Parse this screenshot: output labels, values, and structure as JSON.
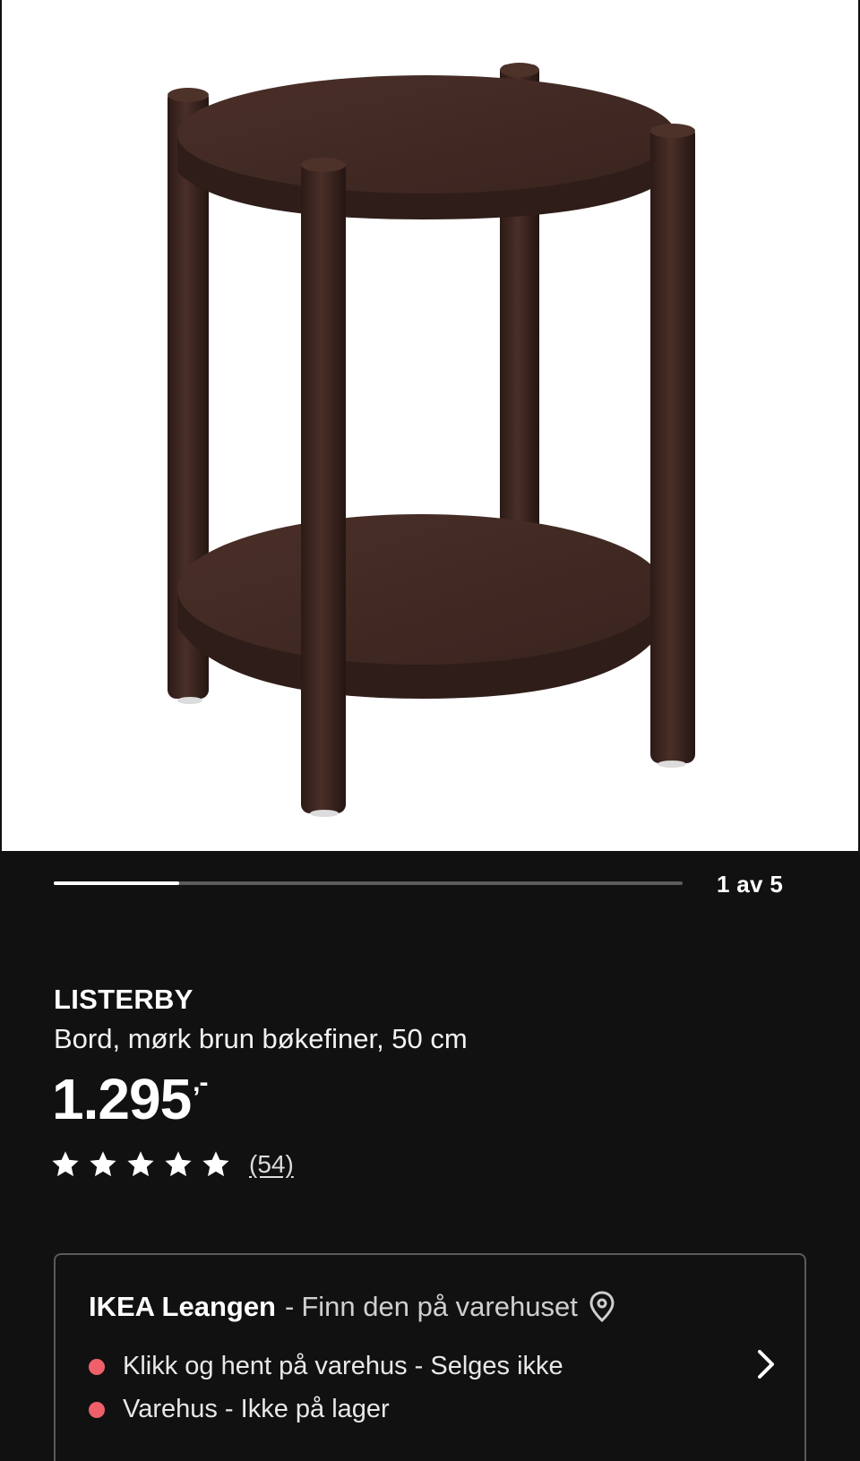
{
  "gallery": {
    "page_indicator": "1 av 5",
    "progress_fraction": 0.2
  },
  "product": {
    "name": "LISTERBY",
    "description": "Bord, mørk brun bøkefiner, 50 cm",
    "price": "1.295",
    "price_suffix": ",-",
    "rating": {
      "stars": 5,
      "max_stars": 5,
      "review_count": "(54)"
    },
    "image_alt_icon": "side-table-image"
  },
  "store": {
    "name": "IKEA Leangen",
    "separator": "-",
    "find_text": "Finn den på varehuset",
    "pin_icon": "location-pin-icon",
    "chevron_icon": "chevron-right-icon",
    "statuses": [
      {
        "label": "Klikk og hent på varehus - Selges ikke",
        "color": "#f0606a"
      },
      {
        "label": "Varehus - Ikke på lager",
        "color": "#f0606a"
      }
    ]
  },
  "colors": {
    "background": "#111111",
    "wood": "#3a2420",
    "status_red": "#f0606a"
  }
}
